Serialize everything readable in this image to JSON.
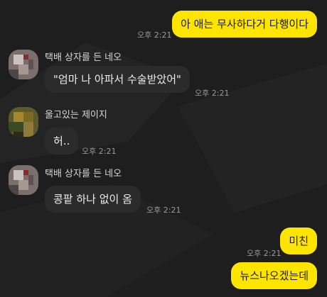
{
  "messages": [
    {
      "from": "me",
      "text": "아 애는 무사하다거 다행이다",
      "time": "오후 2:21"
    },
    {
      "from": "other",
      "sender": "택배 상자를 든 네오",
      "avatar_icon": "pixelated-avatar-icon",
      "text": "\"엄마 나 아파서 수술받았어\"",
      "time": "오후 2:21"
    },
    {
      "from": "other",
      "sender": "울고있는 제이지",
      "avatar_icon": "pixelated-avatar-icon",
      "text": "허..",
      "time": "오후 2:21"
    },
    {
      "from": "other",
      "sender": "택배 상자를 든 네오",
      "avatar_icon": "pixelated-avatar-icon",
      "text": "콩팥 하나 없이 옴",
      "time": "오후 2:21"
    },
    {
      "from": "me",
      "text": "미친",
      "time": "오후 2:21"
    },
    {
      "from": "me",
      "text": "뉴스나오겠는데"
    }
  ],
  "colors": {
    "background": "#1e1e1f",
    "my_bubble": "#fee500",
    "other_bubble": "#2b2b2c"
  }
}
